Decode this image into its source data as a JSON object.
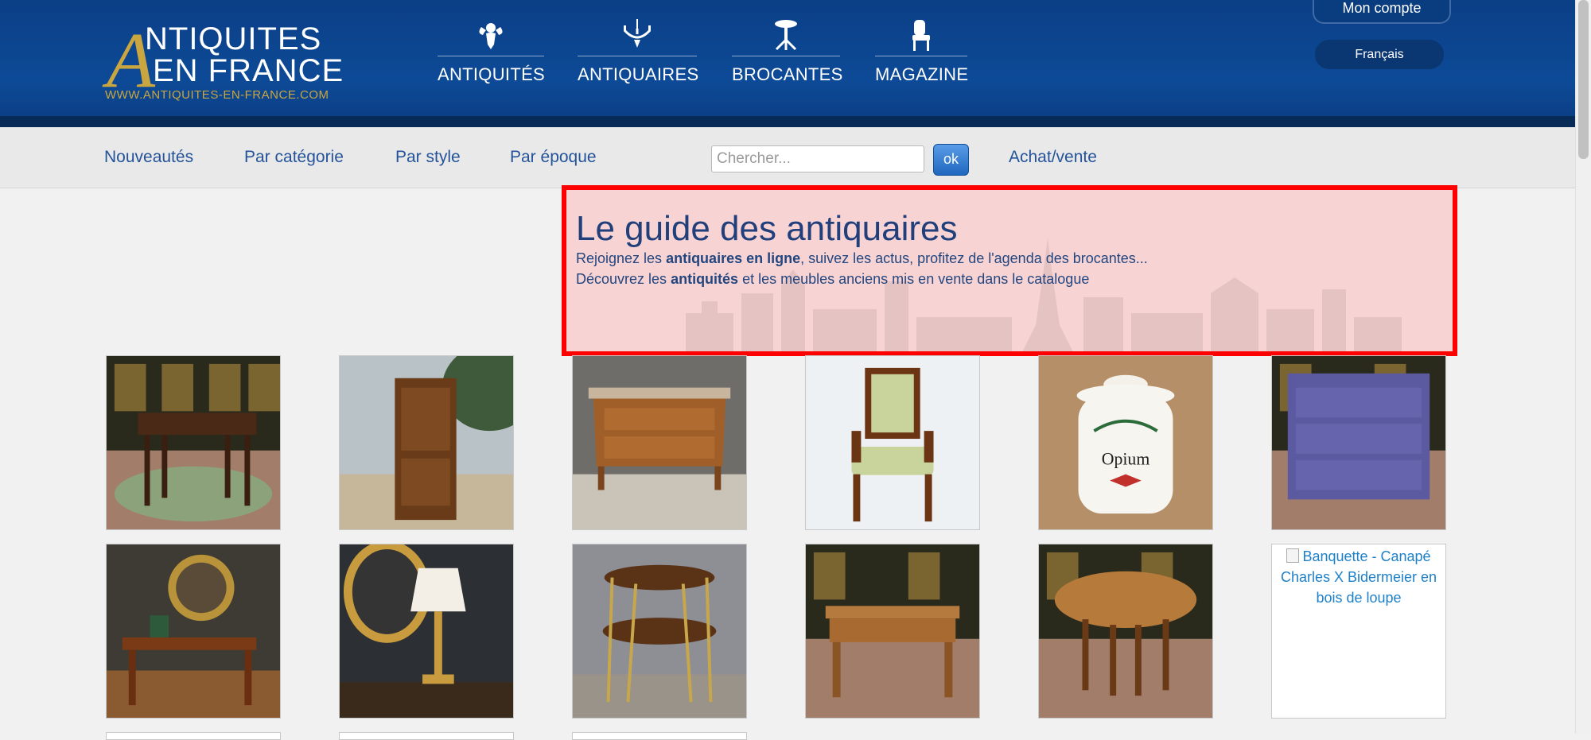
{
  "header": {
    "logo": {
      "big_letter": "A",
      "line1": "NTIQUITES",
      "line2": "EN FRANCE",
      "url": "WWW.ANTIQUITES-EN-FRANCE.COM"
    },
    "nav": [
      {
        "label": "ANTIQUITÉS",
        "icon": "cherub-icon"
      },
      {
        "label": "ANTIQUAIRES",
        "icon": "chandelier-icon"
      },
      {
        "label": "BROCANTES",
        "icon": "pedestal-table-icon"
      },
      {
        "label": "MAGAZINE",
        "icon": "chair-icon"
      }
    ],
    "account_label": "Mon compte",
    "language_label": "Français"
  },
  "subnav": {
    "links": [
      "Nouveautés",
      "Par catégorie",
      "Par style",
      "Par époque"
    ],
    "search_placeholder": "Chercher...",
    "search_button": "ok",
    "achat_vente": "Achat/vente"
  },
  "guide": {
    "title": "Le guide des antiquaires",
    "line1_pre": "Rejoignez les ",
    "line1_bold": "antiquaires en ligne",
    "line1_post": ", suivez les actus, profitez de l'agenda des brocantes...",
    "line2_pre": "Découvrez les ",
    "line2_bold": "antiquités",
    "line2_post": " et les meubles anciens mis en vente dans le catalogue"
  },
  "products": {
    "broken_alt": "Banquette - Canapé Charles X Bidermeier en bois de loupe",
    "jar_label": "Opium"
  },
  "colors": {
    "header_blue": "#0d4a97",
    "link_blue": "#24539a",
    "gold": "#c9a640",
    "highlight_red": "#ff0000"
  }
}
